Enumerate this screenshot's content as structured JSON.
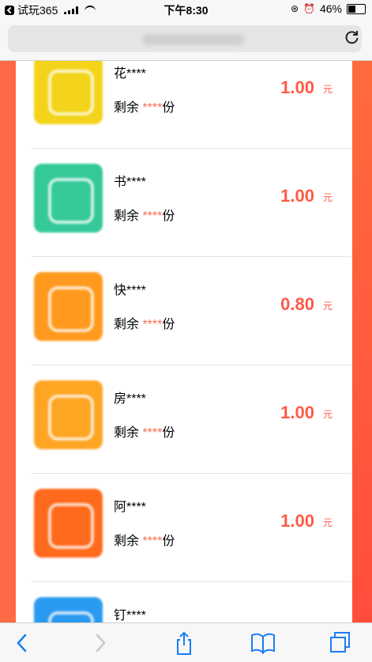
{
  "status": {
    "carrier": "试玩365",
    "time": "下午8:30",
    "battery": "46%",
    "battery_level": 0.46
  },
  "toolbar": {
    "back_icon": "chevron-left-icon",
    "forward_icon": "chevron-right-icon",
    "share_icon": "share-icon",
    "bookmarks_icon": "book-icon",
    "tabs_icon": "tabs-icon"
  },
  "colors": {
    "accent": "#ff5a46",
    "background": "#ff5a3c"
  },
  "items": [
    {
      "name": "花****",
      "remain_prefix": "剩余 ",
      "remain_stars": "****",
      "remain_suffix": "份",
      "price": "1.00",
      "unit": "元",
      "thumb_color": "#f3d41a"
    },
    {
      "name": "书****",
      "remain_prefix": "剩余 ",
      "remain_stars": "****",
      "remain_suffix": "份",
      "price": "1.00",
      "unit": "元",
      "thumb_color": "#35c99a"
    },
    {
      "name": "快****",
      "remain_prefix": "剩余 ",
      "remain_stars": "****",
      "remain_suffix": "份",
      "price": "0.80",
      "unit": "元",
      "thumb_color": "#ff9a1e"
    },
    {
      "name": "房****",
      "remain_prefix": "剩余 ",
      "remain_stars": "****",
      "remain_suffix": "份",
      "price": "1.00",
      "unit": "元",
      "thumb_color": "#ffa524"
    },
    {
      "name": "阿****",
      "remain_prefix": "剩余 ",
      "remain_stars": "****",
      "remain_suffix": "份",
      "price": "1.00",
      "unit": "元",
      "thumb_color": "#ff6a1c"
    },
    {
      "name": "钉****",
      "remain_prefix": "",
      "remain_stars": "",
      "remain_suffix": "",
      "price": "",
      "unit": "",
      "thumb_color": "#2a9af0"
    }
  ]
}
